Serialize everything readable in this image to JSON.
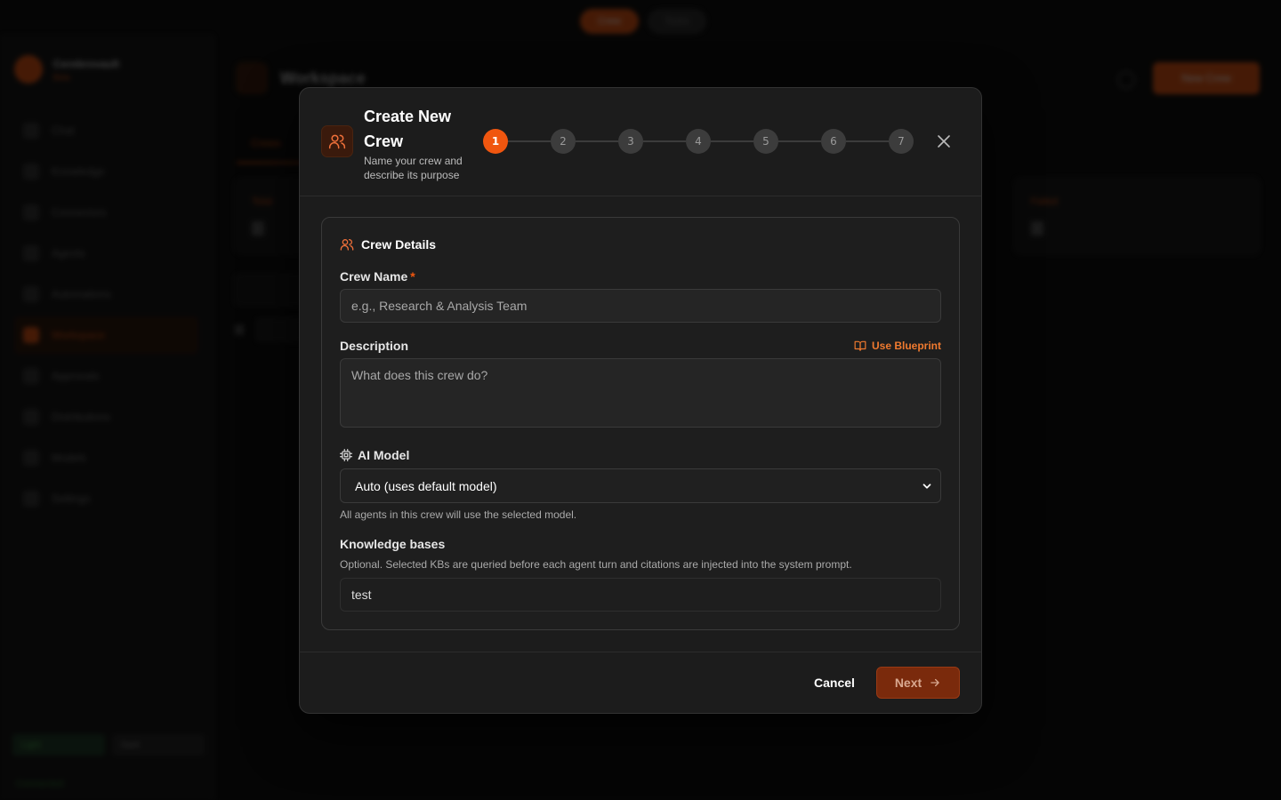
{
  "background": {
    "toggle": [
      "Crew",
      "Tasks"
    ],
    "brand": {
      "name": "Cerebrovault",
      "sub": "Beta"
    },
    "nav": [
      "Chat",
      "Knowledge",
      "Connectors",
      "Agents",
      "Automations",
      "Workspace",
      "Approvals",
      "Distributions",
      "Models",
      "Settings"
    ],
    "workspace_title": "Workspace",
    "new_crew_button": "New Crew",
    "tab": "Crews",
    "cards": [
      "Total",
      "Failed"
    ],
    "footer_chips": [
      "Light",
      "Dark"
    ],
    "status": "Connected"
  },
  "modal": {
    "title": "Create New Crew",
    "subtitle": "Name your crew and describe its purpose",
    "steps": [
      "1",
      "2",
      "3",
      "4",
      "5",
      "6",
      "7"
    ],
    "active_step": 1,
    "section_title": "Crew Details",
    "crew_name": {
      "label": "Crew Name",
      "required_mark": "*",
      "placeholder": "e.g., Research & Analysis Team",
      "value": ""
    },
    "description": {
      "label": "Description",
      "placeholder": "What does this crew do?",
      "value": "",
      "blueprint_label": "Use Blueprint"
    },
    "ai_model": {
      "label": "AI Model",
      "selected": "Auto (uses default model)",
      "helper": "All agents in this crew will use the selected model."
    },
    "knowledge_bases": {
      "label": "Knowledge bases",
      "helper": "Optional. Selected KBs are queried before each agent turn and citations are injected into the system prompt.",
      "value": "test"
    },
    "cancel_label": "Cancel",
    "next_label": "Next"
  },
  "colors": {
    "accent": "#f0560f",
    "background": "#0a0a0a",
    "modal": "#1c1c1c"
  }
}
